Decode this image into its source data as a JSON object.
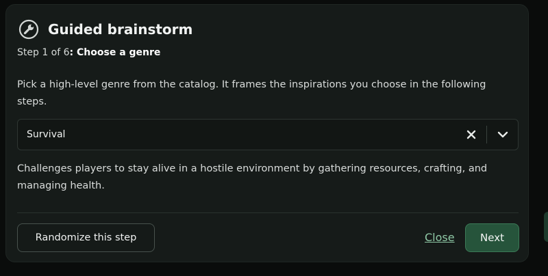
{
  "dialog": {
    "title": "Guided brainstorm",
    "title_icon": "wrench-icon",
    "step_prefix": "Step 1 of 6",
    "step_separator": ": ",
    "step_name": "Choose a genre",
    "description": "Pick a high-level genre from the catalog. It frames the inspirations you choose in the following steps."
  },
  "genre_select": {
    "value": "Survival",
    "clear_icon": "close-icon",
    "toggle_icon": "chevron-down-icon"
  },
  "genre_description": "Challenges players to stay alive in a hostile environment by gathering resources, crafting, and managing health.",
  "footer": {
    "randomize_label": "Randomize this step",
    "close_label": "Close",
    "next_label": "Next"
  },
  "colors": {
    "dialog_background": "#161b19",
    "primary_button": "#26543b",
    "link": "#8fc9a6"
  }
}
